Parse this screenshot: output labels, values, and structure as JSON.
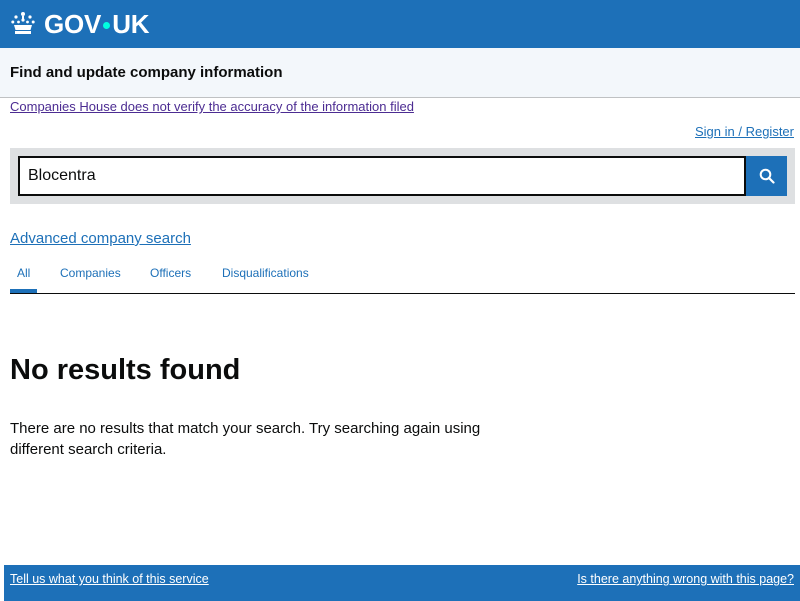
{
  "header": {
    "logo_text_left": "GOV",
    "logo_text_right": "UK",
    "logo_icon": "crown-icon",
    "background": "#1d70b8"
  },
  "service": {
    "name": "Find and update company information"
  },
  "notice": {
    "disclaimer": "Companies House does not verify the accuracy of the information filed"
  },
  "account": {
    "signin": "Sign in / Register"
  },
  "search": {
    "value": "Blocentra",
    "button_icon": "search-icon"
  },
  "advanced_search": {
    "label": "Advanced company search"
  },
  "tabs": [
    {
      "label": "All",
      "selected": true
    },
    {
      "label": "Companies",
      "selected": false
    },
    {
      "label": "Officers",
      "selected": false
    },
    {
      "label": "Disqualifications",
      "selected": false
    }
  ],
  "results": {
    "heading": "No results found",
    "message": "There are no results that match your search. Try searching again using different search criteria."
  },
  "footer": {
    "feedback": "Tell us what you think of this service",
    "report": "Is there anything wrong with this page?"
  },
  "colors": {
    "brand_blue": "#1d70b8",
    "visited_link": "#4c2c92",
    "logo_dot": "#00ffe0"
  }
}
